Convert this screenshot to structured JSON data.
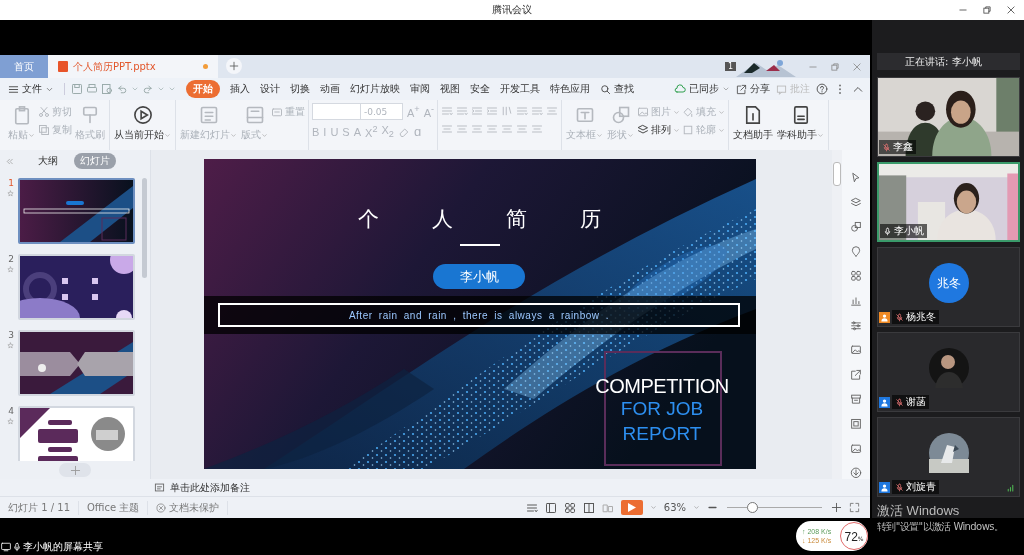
{
  "window": {
    "title": "腾讯会议"
  },
  "editor": {
    "tabs": [
      {
        "label": "首页",
        "kind": "home",
        "selected": false,
        "unsaved": false
      },
      {
        "label": "个人简历PPT.pptx",
        "kind": "document",
        "selected": true,
        "unsaved": true
      }
    ],
    "skin_badge": "1",
    "file_menu": "文件",
    "menu_tabs": [
      {
        "label": "开始",
        "selected": true
      },
      {
        "label": "插入",
        "selected": false
      },
      {
        "label": "设计",
        "selected": false
      },
      {
        "label": "切换",
        "selected": false
      },
      {
        "label": "动画",
        "selected": false
      },
      {
        "label": "幻灯片放映",
        "selected": false
      },
      {
        "label": "审阅",
        "selected": false
      },
      {
        "label": "视图",
        "selected": false
      },
      {
        "label": "安全",
        "selected": false
      },
      {
        "label": "开发工具",
        "selected": false
      },
      {
        "label": "特色应用",
        "selected": false
      }
    ],
    "search": "查找",
    "sync": "已同步",
    "share": "分享",
    "comment": {
      "label": "批注",
      "disabled": true
    },
    "ribbon": [
      [
        {
          "kind": "large",
          "label": "粘贴",
          "disabled": true,
          "dropdown": true
        },
        {
          "kind": "stack",
          "items": [
            {
              "label": "剪切",
              "disabled": true,
              "dropdown": false
            },
            {
              "label": "复制",
              "disabled": true,
              "dropdown": false
            }
          ]
        },
        {
          "kind": "large",
          "label": "格式刷",
          "disabled": true,
          "dropdown": false
        }
      ],
      [
        {
          "kind": "large",
          "label": "从当前开始",
          "disabled": false,
          "dropdown": true
        }
      ],
      [
        {
          "kind": "large",
          "label": "新建幻灯片",
          "disabled": true,
          "dropdown": true
        },
        {
          "kind": "large",
          "label": "版式",
          "disabled": true,
          "dropdown": true
        },
        {
          "kind": "stack",
          "items": [
            {
              "label": "重置",
              "disabled": true,
              "dropdown": false
            }
          ]
        }
      ],
      [
        {
          "kind": "font",
          "disabled": true,
          "size": "-0.05",
          "size_buttons": [
            "A$^{+}$",
            "A$^{-}$"
          ],
          "format_buttons": [
            "B",
            "I",
            "U",
            "S",
            "A",
            "X$^{2}$",
            "X$_{2}$"
          ],
          "case_button": "ɑ"
        }
      ],
      [
        {
          "kind": "paragraph",
          "disabled": true
        }
      ],
      [
        {
          "kind": "large",
          "label": "文本框",
          "disabled": true,
          "dropdown": true
        },
        {
          "kind": "large",
          "label": "形状",
          "disabled": true,
          "dropdown": true
        },
        {
          "kind": "stack",
          "items": [
            {
              "label": "图片",
              "disabled": true,
              "dropdown": true
            },
            {
              "label": "排列",
              "disabled": false,
              "dropdown": true
            }
          ]
        },
        {
          "kind": "stack",
          "items": [
            {
              "label": "填充",
              "disabled": true,
              "dropdown": true
            },
            {
              "label": "轮廓",
              "disabled": true,
              "dropdown": true
            }
          ]
        }
      ],
      [
        {
          "kind": "large",
          "label": "文档助手",
          "disabled": false,
          "dropdown": false
        },
        {
          "kind": "large",
          "label": "学科助手",
          "disabled": false,
          "dropdown": true
        }
      ]
    ],
    "panel_tabs": [
      {
        "label": "大纲",
        "selected": false
      },
      {
        "label": "幻灯片",
        "selected": true
      }
    ],
    "thumbnails": [
      {
        "number": "1",
        "kind": "cover",
        "selected": true
      },
      {
        "number": "2",
        "kind": "contents",
        "selected": false
      },
      {
        "number": "3",
        "kind": "section",
        "selected": false
      },
      {
        "number": "4",
        "kind": "profile",
        "selected": false
      }
    ],
    "slide": {
      "title": "个人简历",
      "name": "李小帆",
      "tagline": "After rain and rain , there is always a rainbow .",
      "report_lines": [
        "COMPETITION",
        "FOR JOB",
        "REPORT"
      ]
    },
    "notes_placeholder": "单击此处添加备注",
    "status": {
      "slide": "幻灯片 1 / 11",
      "theme": "Office 主题",
      "protection": "文档未保护",
      "zoom": "63%",
      "zoom_slider": {
        "level": 0.26
      }
    }
  },
  "panel": {
    "speaker": "正在讲话: 李小帆",
    "participants": [
      {
        "name": "李鑫",
        "kind": "video",
        "selected": false,
        "muted": true,
        "signal": false
      },
      {
        "name": "李小帆",
        "kind": "video",
        "selected": true,
        "muted": false,
        "signal": false
      },
      {
        "name": "杨兆冬",
        "kind": "initials",
        "initials": "兆冬",
        "color": "#f08a24",
        "selected": false,
        "muted": true,
        "signal": false
      },
      {
        "name": "谢菡",
        "color": "#1f78e0",
        "selected": false,
        "muted": true,
        "signal": false
      },
      {
        "name": "刘旋青",
        "color": "#1f78e0",
        "selected": false,
        "muted": true,
        "signal": true
      }
    ]
  },
  "share_label": "李小帆的屏幕共享",
  "network": {
    "upload": "↑ 208 K/s",
    "download": "↓ 125 K/s",
    "value": "72",
    "unit": "%"
  },
  "activation": {
    "title": "激活 Windows",
    "hint": "转到\"设置\"以激活 Windows。"
  }
}
